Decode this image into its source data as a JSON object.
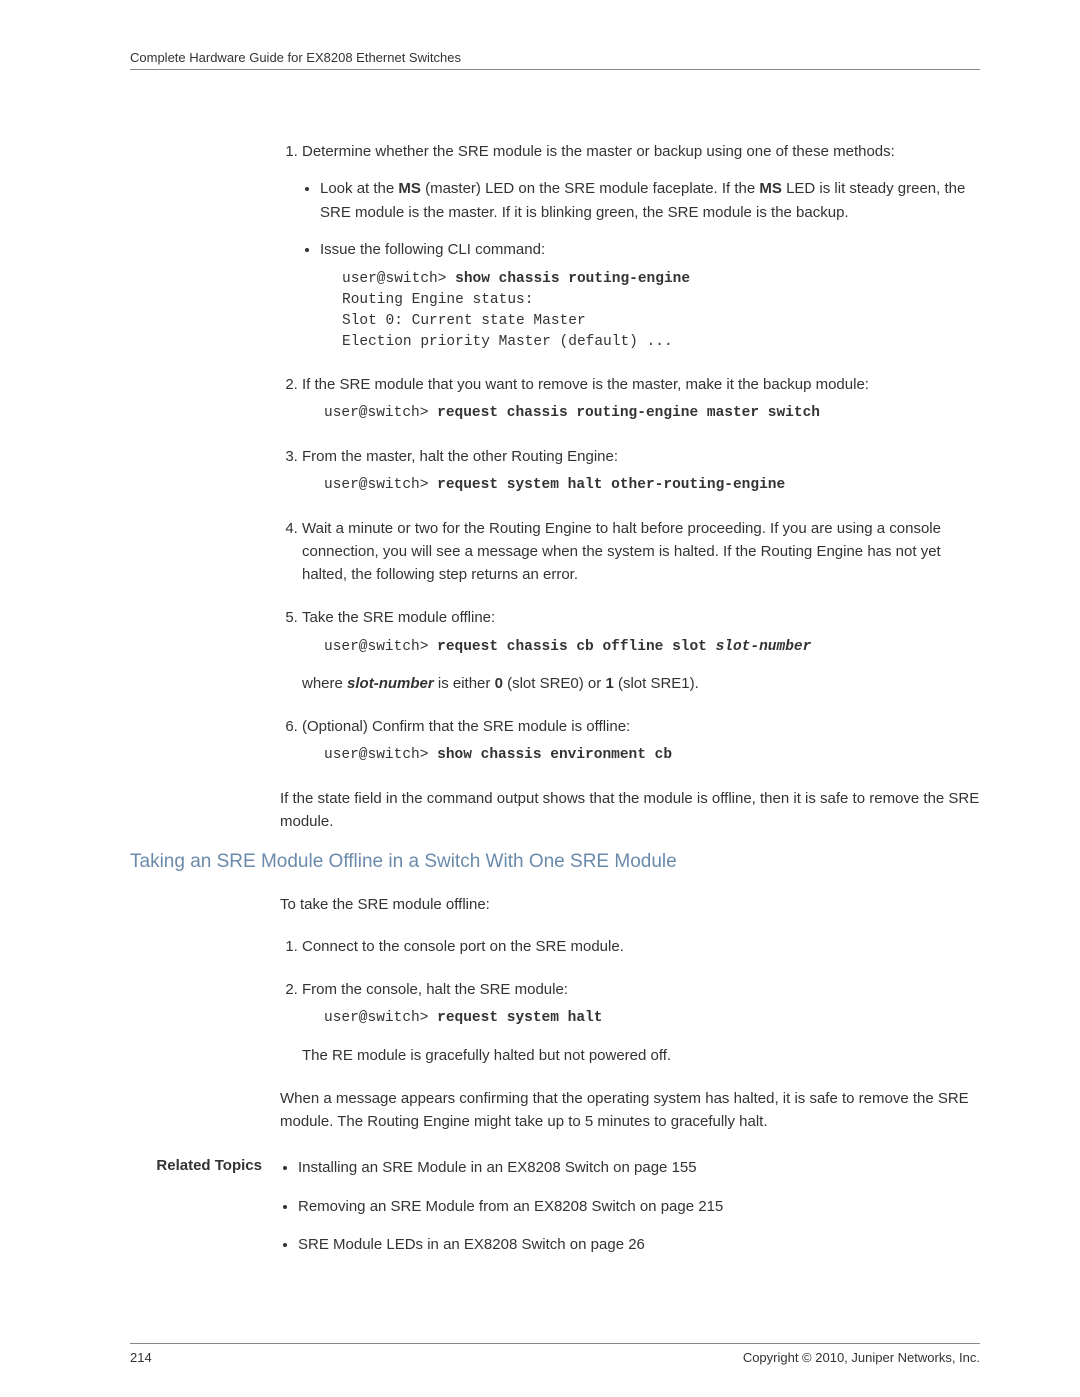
{
  "header": {
    "title": "Complete Hardware Guide for EX8208 Ethernet Switches"
  },
  "procedure1": {
    "step1": {
      "text": "Determine whether the SRE module is the master or backup using one of these methods:",
      "bullet1_prefix": "Look at the ",
      "bullet1_bold1": "MS",
      "bullet1_mid": " (master) LED on the SRE module faceplate. If the ",
      "bullet1_bold2": "MS",
      "bullet1_suffix": " LED is lit steady green, the SRE module is the master. If it is blinking green, the SRE module is the backup.",
      "bullet2": "Issue the following CLI command:",
      "code_prompt": "user@switch> ",
      "code_cmd": "show chassis routing-engine",
      "code_line2": "Routing Engine status:",
      "code_line3": "Slot 0: Current state Master",
      "code_line4": "Election priority Master (default) ..."
    },
    "step2": {
      "text": "If the SRE module that you want to remove is the master, make it the backup module:",
      "prompt": "user@switch> ",
      "cmd": "request chassis routing-engine master switch"
    },
    "step3": {
      "text": "From the master, halt the other Routing Engine:",
      "prompt": "user@switch> ",
      "cmd": "request system halt other-routing-engine"
    },
    "step4": {
      "text": "Wait a minute or two for the Routing Engine to halt before proceeding. If you are using a console connection, you will see a message when the system is halted. If the Routing Engine has not yet halted, the following step returns an error."
    },
    "step5": {
      "text": "Take the SRE module offline:",
      "prompt": "user@switch> ",
      "cmd": "request chassis cb offline slot ",
      "cmd_arg": "slot-number",
      "followup_prefix": "where ",
      "followup_bi": "slot-number",
      "followup_mid1": " is either ",
      "followup_b1": "0",
      "followup_mid2": " (slot SRE0) or ",
      "followup_b2": "1",
      "followup_suffix": " (slot SRE1)."
    },
    "step6": {
      "text": "(Optional) Confirm that the SRE module is offline:",
      "prompt": "user@switch> ",
      "cmd": "show chassis environment cb"
    },
    "tail": "If the state field in the command output shows that the module is offline, then it is safe to remove the SRE module."
  },
  "section2": {
    "heading": "Taking an SRE Module Offline in a Switch With One SRE Module",
    "intro": "To take the SRE module offline:",
    "step1": "Connect to the console port on the SRE module.",
    "step2": {
      "text": "From the console, halt the SRE module:",
      "prompt": "user@switch> ",
      "cmd": "request system halt",
      "note": "The RE module is gracefully halted but not powered off."
    },
    "tail": "When a message appears confirming that the operating system has halted, it is safe to remove the SRE module. The Routing Engine might take up to 5 minutes to gracefully halt."
  },
  "related": {
    "label": "Related Topics",
    "item1": "Installing an SRE Module in an EX8208 Switch on page 155",
    "item2": "Removing an SRE Module from an EX8208 Switch on page 215",
    "item3": "SRE Module LEDs in an EX8208 Switch on page 26"
  },
  "footer": {
    "page": "214",
    "copyright": "Copyright © 2010, Juniper Networks, Inc."
  }
}
